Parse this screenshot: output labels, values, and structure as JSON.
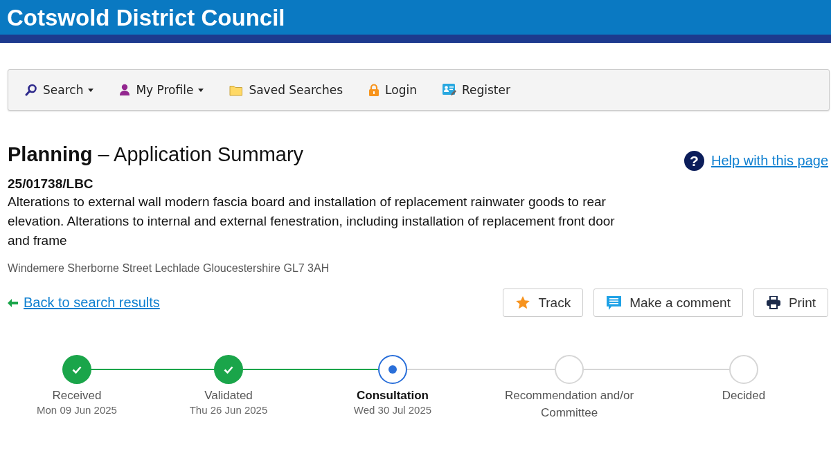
{
  "header": {
    "title": "Cotswold District Council"
  },
  "nav": [
    {
      "label": "Search",
      "dropdown": true
    },
    {
      "label": "My Profile",
      "dropdown": true
    },
    {
      "label": "Saved Searches",
      "dropdown": false
    },
    {
      "label": "Login",
      "dropdown": false
    },
    {
      "label": "Register",
      "dropdown": false
    }
  ],
  "page": {
    "title_bold": "Planning",
    "title_rest": "– Application Summary",
    "help_icon": "?",
    "help_link": "Help with this page"
  },
  "application": {
    "reference": "25/01738/LBC",
    "description": "Alterations to external wall modern fascia board and installation of replacement rainwater goods to rear elevation. Alterations to internal and external fenestration, including installation of replacement front door and frame",
    "address": "Windemere Sherborne Street Lechlade Gloucestershire GL7 3AH"
  },
  "back_link": "Back to search results",
  "actions": [
    {
      "label": "Track"
    },
    {
      "label": "Make a comment"
    },
    {
      "label": "Print"
    }
  ],
  "progress": [
    {
      "label": "Received",
      "date": "Mon 09 Jun 2025",
      "kind": "done"
    },
    {
      "label": "Validated",
      "date": "Thu 26 Jun 2025",
      "kind": "done"
    },
    {
      "label": "Consultation",
      "date": "Wed 30 Jul 2025",
      "kind": "current"
    },
    {
      "label": "Recommendation and/or Committee",
      "kind": "pending"
    },
    {
      "label": "Decided",
      "kind": "pending"
    }
  ]
}
